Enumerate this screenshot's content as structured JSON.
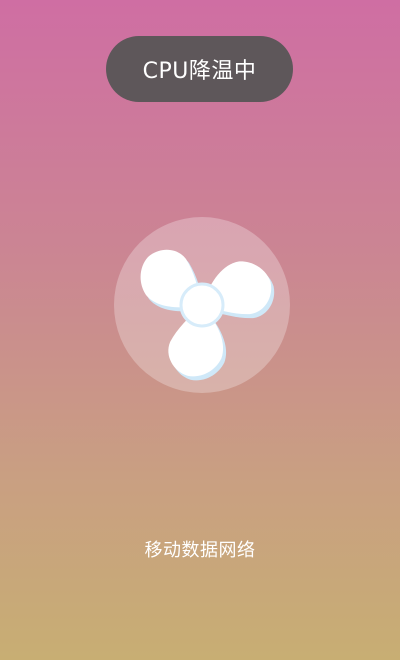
{
  "status": {
    "label": "CPU降温中"
  },
  "fan": {
    "icon": "fan-icon"
  },
  "network": {
    "label": "移动数据网络"
  },
  "colors": {
    "background_top": "#cf6ea3",
    "background_bottom": "#c8ae73",
    "pill": "#555555",
    "fan_blade": "#ffffff",
    "fan_shadow": "#cfe8f8"
  }
}
